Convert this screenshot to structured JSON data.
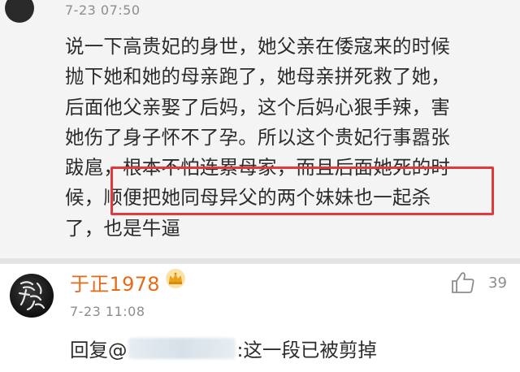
{
  "top_comment": {
    "timestamp": "7-23 07:50",
    "lines": [
      "说一下高贵妃的身世，她父亲在倭寇来的时候",
      "抛下她和她的母亲跑了，她母亲拼死救了她，",
      "后面他父亲娶了后妈，这个后妈心狠手辣，害",
      "她伤了身子怀不了孕。所以这个贵妃行事嚣张",
      "跋扈，根本不怕连累母家，而且后面她死的时",
      "候，顺便把她同母异父的两个妹妹也一起杀",
      "了，也是牛逼"
    ]
  },
  "reply": {
    "username": "于正1978",
    "timestamp": "7-23 11:08",
    "like_count": "39",
    "reply_prefix": "回复@",
    "reply_suffix": ":这一段已被剪掉"
  },
  "colors": {
    "highlight_border": "#e0393e",
    "username": "#e86a17",
    "verified_badge": "#f5a623",
    "crown": "#e9a21a"
  },
  "icons": {
    "like": "thumbs-up-icon",
    "crown": "crown-icon",
    "verified": "verified-badge-icon"
  }
}
